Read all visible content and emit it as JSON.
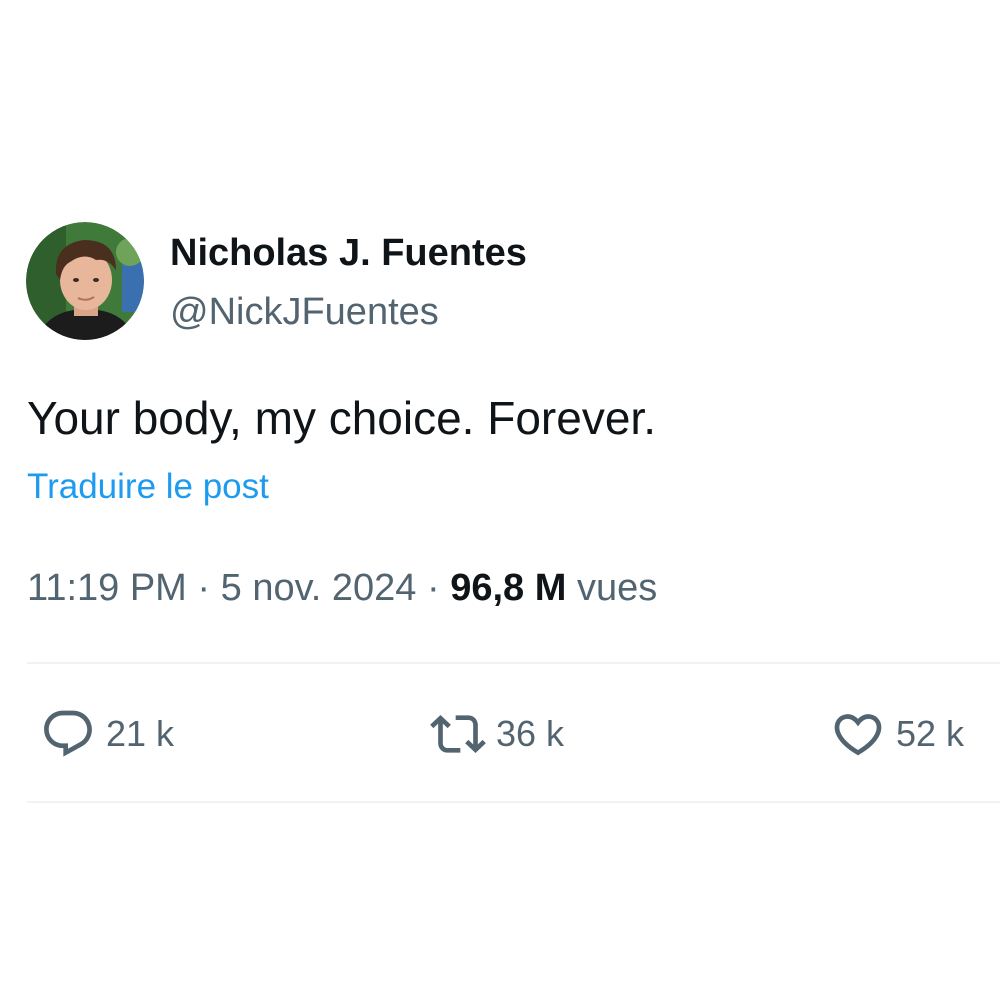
{
  "author": {
    "name": "Nicholas J. Fuentes",
    "handle": "@NickJFuentes",
    "avatar_icon": "profile-photo"
  },
  "post": {
    "text": "Your body, my choice. Forever.",
    "translate_label": "Traduire le post"
  },
  "meta": {
    "time": "11:19 PM",
    "separator": "·",
    "date": "5 nov. 2024",
    "views_count": "96,8 M",
    "views_label": "vues"
  },
  "actions": {
    "reply": {
      "icon": "reply-icon",
      "count": "21 k"
    },
    "retweet": {
      "icon": "retweet-icon",
      "count": "36 k"
    },
    "like": {
      "icon": "heart-icon",
      "count": "52 k"
    }
  },
  "colors": {
    "text_primary": "#0f1419",
    "text_secondary": "#536471",
    "link": "#1d9bf0",
    "divider": "#eff3f4"
  }
}
